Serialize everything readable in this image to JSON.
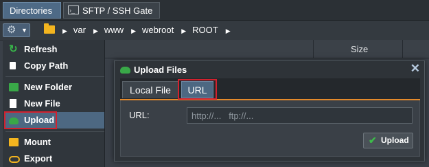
{
  "tabs": [
    {
      "label": "Directories",
      "active": true
    },
    {
      "label": "SFTP / SSH Gate",
      "active": false
    }
  ],
  "toolbar": {
    "settings_icon": "gear-icon",
    "breadcrumb": [
      "var",
      "www",
      "webroot",
      "ROOT"
    ]
  },
  "table": {
    "columns": [
      "Size"
    ]
  },
  "menu": {
    "items": [
      {
        "label": "Refresh",
        "icon": "refresh-icon"
      },
      {
        "label": "Copy Path",
        "icon": "copy-icon"
      },
      {
        "label": "New Folder",
        "icon": "folder-icon"
      },
      {
        "label": "New File",
        "icon": "file-icon"
      },
      {
        "label": "Upload",
        "icon": "cloud-upload-icon",
        "active": true
      },
      {
        "label": "Mount",
        "icon": "folder-icon"
      },
      {
        "label": "Export",
        "icon": "link-icon"
      }
    ]
  },
  "dialog": {
    "title": "Upload Files",
    "tabs": [
      "Local File",
      "URL"
    ],
    "active_tab": "URL",
    "url_label": "URL:",
    "url_placeholder": "http://...   ftp://...",
    "url_value": "",
    "upload_label": "Upload"
  },
  "colors": {
    "accent": "#e58a2b",
    "highlight": "#d3212e",
    "active": "#4d6882"
  }
}
